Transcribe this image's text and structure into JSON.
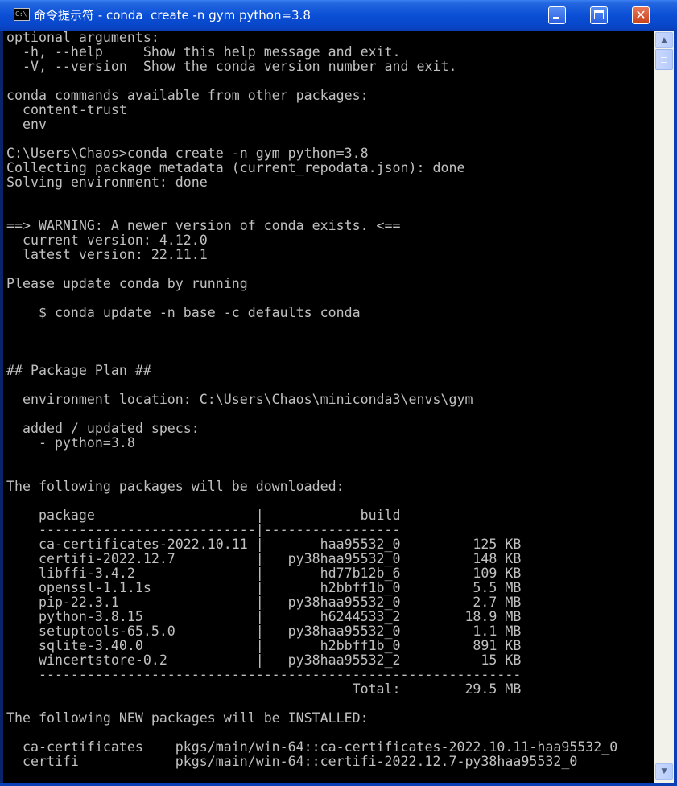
{
  "window": {
    "title": "命令提示符 - conda  create -n gym python=3.8",
    "icon_text": "C:\\"
  },
  "console": {
    "text_color": "#c0c0c0",
    "background": "#000000",
    "lines": [
      "optional arguments:",
      "  -h, --help     Show this help message and exit.",
      "  -V, --version  Show the conda version number and exit.",
      "",
      "conda commands available from other packages:",
      "  content-trust",
      "  env",
      "",
      "C:\\Users\\Chaos>conda create -n gym python=3.8",
      "Collecting package metadata (current_repodata.json): done",
      "Solving environment: done",
      "",
      "",
      "==> WARNING: A newer version of conda exists. <==",
      "  current version: 4.12.0",
      "  latest version: 22.11.1",
      "",
      "Please update conda by running",
      "",
      "    $ conda update -n base -c defaults conda",
      "",
      "",
      "",
      "## Package Plan ##",
      "",
      "  environment location: C:\\Users\\Chaos\\miniconda3\\envs\\gym",
      "",
      "  added / updated specs:",
      "    - python=3.8",
      "",
      "",
      "The following packages will be downloaded:",
      "",
      "    package                    |            build",
      "    ---------------------------|-----------------",
      "    ca-certificates-2022.10.11 |       haa95532_0         125 KB",
      "    certifi-2022.12.7          |   py38haa95532_0         148 KB",
      "    libffi-3.4.2               |       hd77b12b_6         109 KB",
      "    openssl-1.1.1s             |       h2bbff1b_0         5.5 MB",
      "    pip-22.3.1                 |   py38haa95532_0         2.7 MB",
      "    python-3.8.15              |       h6244533_2        18.9 MB",
      "    setuptools-65.5.0          |   py38haa95532_0         1.1 MB",
      "    sqlite-3.40.0              |       h2bbff1b_0         891 KB",
      "    wincertstore-0.2           |   py38haa95532_2          15 KB",
      "    ------------------------------------------------------------",
      "                                           Total:        29.5 MB",
      "",
      "The following NEW packages will be INSTALLED:",
      "",
      "  ca-certificates    pkgs/main/win-64::ca-certificates-2022.10.11-haa95532_0",
      "  certifi            pkgs/main/win-64::certifi-2022.12.7-py38haa95532_0"
    ]
  },
  "scrollbar": {
    "up_icon": "scroll-up-arrow-icon",
    "down_icon": "scroll-down-arrow-icon"
  }
}
